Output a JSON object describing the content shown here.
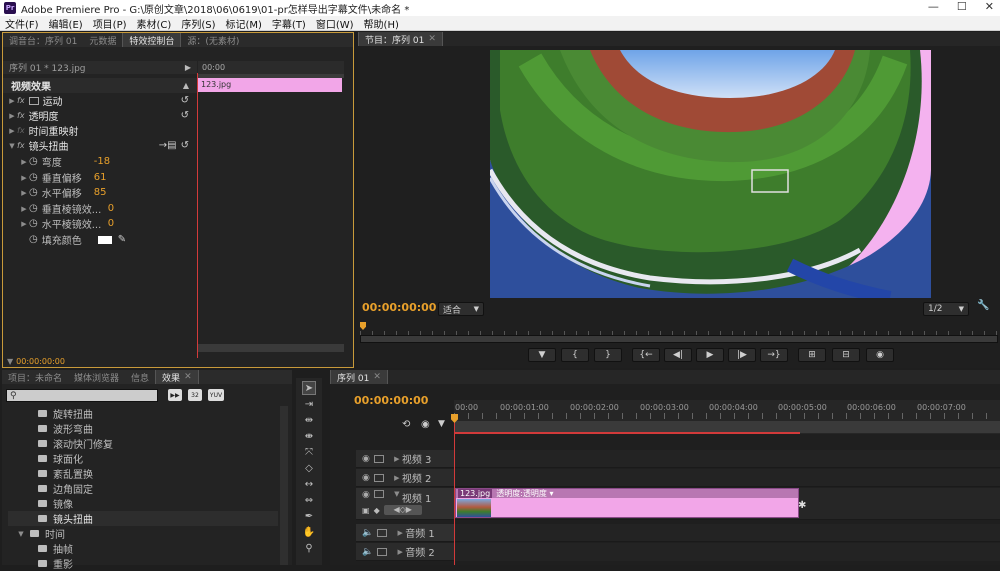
{
  "window": {
    "app_logo": "Pr",
    "title": "Adobe Premiere Pro - G:\\原创文章\\2018\\06\\0619\\01-pr怎样导出字幕文件\\未命名 *",
    "controls": [
      "—",
      "☐",
      "✕"
    ]
  },
  "menu": [
    "文件(F)",
    "编辑(E)",
    "项目(P)",
    "素材(C)",
    "序列(S)",
    "标记(M)",
    "字幕(T)",
    "窗口(W)",
    "帮助(H)"
  ],
  "left_top": {
    "tabs": [
      "调音台：序列 01",
      "元数据",
      "特效控制台",
      "源：(无素材)"
    ],
    "active_tab": "特效控制台",
    "header": "序列 01 * 123.jpg",
    "timecode_start": "00:00",
    "clip_label": "123.jpg",
    "section": "视频效果",
    "effects": [
      {
        "name": "运动"
      },
      {
        "name": "透明度"
      },
      {
        "name": "时间重映射"
      },
      {
        "name": "镜头扭曲"
      }
    ],
    "params": [
      {
        "name": "弯度",
        "value": "-18"
      },
      {
        "name": "垂直偏移",
        "value": "61"
      },
      {
        "name": "水平偏移",
        "value": "85"
      },
      {
        "name": "垂直棱镜效...",
        "value": "0"
      },
      {
        "name": "水平棱镜效...",
        "value": "0"
      },
      {
        "name": "填充颜色",
        "value": ""
      }
    ],
    "bottom_time": "00:00:00:00"
  },
  "program": {
    "tab": "节目：序列 01",
    "timecode": "00:00:00:00",
    "fit": "适合",
    "resolution": "1/2",
    "transport": [
      "▼",
      "{",
      "}",
      "{←",
      "◀|",
      "▶",
      "|▶",
      "→}",
      "⊞",
      "⊟",
      "◉"
    ],
    "wrench": "🔧"
  },
  "bottom_left": {
    "tabs": [
      "项目：未命名",
      "媒体浏览器",
      "信息",
      "效果"
    ],
    "active_tab": "效果",
    "search_placeholder": "",
    "filter_badges": [
      "▶▶",
      "32",
      "YUV"
    ],
    "items": [
      {
        "label": "旋转扭曲",
        "type": "effect"
      },
      {
        "label": "波形弯曲",
        "type": "effect"
      },
      {
        "label": "滚动快门修复",
        "type": "effect"
      },
      {
        "label": "球面化",
        "type": "effect"
      },
      {
        "label": "紊乱置换",
        "type": "effect"
      },
      {
        "label": "边角固定",
        "type": "effect"
      },
      {
        "label": "镜像",
        "type": "effect"
      },
      {
        "label": "镜头扭曲",
        "type": "effect",
        "highlight": true
      },
      {
        "label": "时间",
        "type": "folder"
      },
      {
        "label": "抽帧",
        "type": "effect"
      },
      {
        "label": "重影",
        "type": "effect"
      }
    ]
  },
  "timeline": {
    "tab": "序列 01",
    "timecode": "00:00:00:00",
    "ruler": [
      "00:00",
      "00:00:01:00",
      "00:00:02:00",
      "00:00:03:00",
      "00:00:04:00",
      "00:00:05:00",
      "00:00:06:00",
      "00:00:07:00"
    ],
    "tracks": [
      {
        "name": "视频 3",
        "kind": "video"
      },
      {
        "name": "视频 2",
        "kind": "video"
      },
      {
        "name": "视频 1",
        "kind": "video"
      },
      {
        "name": "音频 1",
        "kind": "audio"
      },
      {
        "name": "音频 2",
        "kind": "audio"
      }
    ],
    "clip_label": "123.jpg",
    "clip_fx": "透明度:透明度 ▾"
  },
  "colors": {
    "accent": "#e8a02b",
    "clip_pink": "#f2a6e8",
    "playhead": "#d23a3a",
    "panel_bg": "#232323"
  }
}
